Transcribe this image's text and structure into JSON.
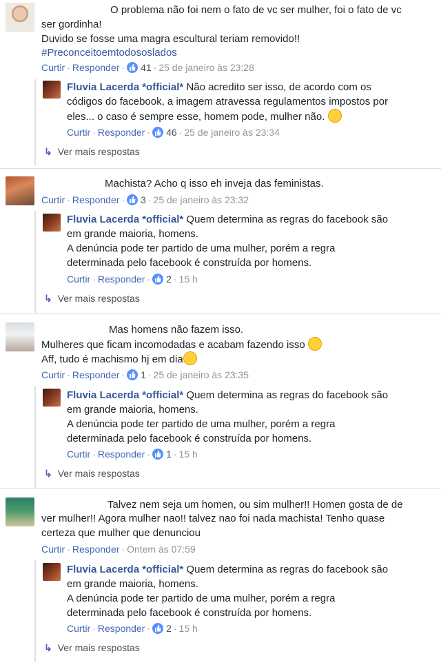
{
  "threads": [
    {
      "comment_lines": [
        "O problema não foi nem o fato de vc ser mulher, foi o fato de vc",
        "ser gordinha!",
        "Duvido se fosse uma magra escultural teriam removido!!"
      ],
      "hashtag": "#Preconceitoemtodososlados",
      "actions": {
        "like": "Curtir",
        "reply": "Responder",
        "reactions": "41",
        "time": "25 de janeiro às 23:28"
      },
      "reply": {
        "author": "Fluvia Lacerda *official*",
        "lines": [
          "Não acredito ser isso, de acordo com os",
          "códigos do facebook, a imagem atravessa regulamentos impostos por",
          "eles... o caso é sempre esse, homem pode, mulher não."
        ],
        "actions": {
          "like": "Curtir",
          "reply": "Responder",
          "reactions": "46",
          "time": "25 de janeiro às 23:34"
        }
      },
      "more": "Ver mais respostas"
    },
    {
      "comment_lines": [
        "Machista? Acho q isso eh inveja das feministas."
      ],
      "actions": {
        "like": "Curtir",
        "reply": "Responder",
        "reactions": "3",
        "time": "25 de janeiro às 23:32"
      },
      "reply": {
        "author": "Fluvia Lacerda *official*",
        "lines": [
          "Quem determina as regras do facebook são",
          "em grande maioria, homens.",
          "A denúncia pode ter partido de uma mulher, porém a regra",
          "determinada pelo facebook é construída por homens."
        ],
        "actions": {
          "like": "Curtir",
          "reply": "Responder",
          "reactions": "2",
          "time": "15 h"
        }
      },
      "more": "Ver mais respostas"
    },
    {
      "comment_lines": [
        "Mas homens não fazem isso.",
        "Mulheres que ficam incomodadas e acabam fazendo isso",
        "Aff, tudo é machismo hj em dia"
      ],
      "actions": {
        "like": "Curtir",
        "reply": "Responder",
        "reactions": "1",
        "time": "25 de janeiro às 23:35"
      },
      "reply": {
        "author": "Fluvia Lacerda *official*",
        "lines": [
          "Quem determina as regras do facebook são",
          "em grande maioria, homens.",
          "A denúncia pode ter partido de uma mulher, porém a regra",
          "determinada pelo facebook é construída por homens."
        ],
        "actions": {
          "like": "Curtir",
          "reply": "Responder",
          "reactions": "1",
          "time": "15 h"
        }
      },
      "more": "Ver mais respostas"
    },
    {
      "comment_lines": [
        "Talvez nem seja um homen, ou sim mulher!! Homen gosta de de",
        "ver mulher!! Agora mulher nao!! talvez nao foi nada machista! Tenho quase",
        "certeza que mulher que denunciou"
      ],
      "actions": {
        "like": "Curtir",
        "reply": "Responder",
        "time": "Ontem às 07:59"
      },
      "reply": {
        "author": "Fluvia Lacerda *official*",
        "lines": [
          "Quem determina as regras do facebook são",
          "em grande maioria, homens.",
          "A denúncia pode ter partido de uma mulher, porém a regra",
          "determinada pelo facebook é construída por homens."
        ],
        "actions": {
          "like": "Curtir",
          "reply": "Responder",
          "reactions": "2",
          "time": "15 h"
        }
      },
      "more": "Ver mais respostas"
    }
  ],
  "icons": {
    "like": "thumbs-up-icon",
    "arrow": "reply-arrow-icon",
    "emoji": "emoji-icon"
  },
  "colors": {
    "link": "#4267b2",
    "name": "#365899",
    "meta": "#90949c",
    "reaction": "#5890ff"
  }
}
